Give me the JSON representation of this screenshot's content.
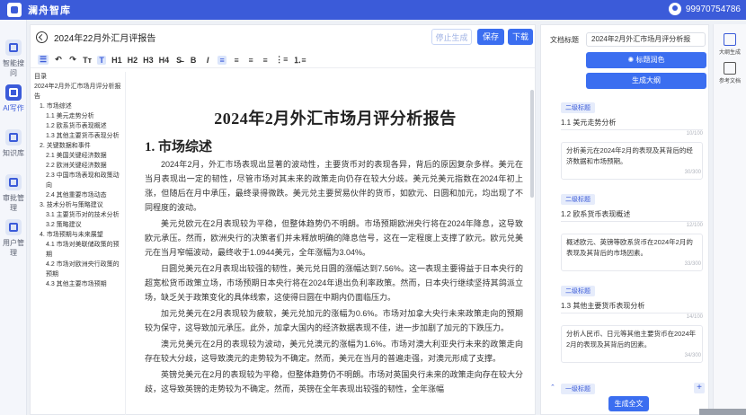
{
  "app": {
    "title": "澜舟智库",
    "user_phone": "99970754786"
  },
  "leftnav": [
    {
      "label": "智能搜问",
      "active": false
    },
    {
      "label": "AI写作",
      "active": true
    },
    {
      "label": "知识库",
      "active": false
    },
    {
      "label": "审批管理",
      "active": false
    },
    {
      "label": "用户管理",
      "active": false
    }
  ],
  "editor": {
    "doc_title": "2024年22月外汇月评报告",
    "buttons": {
      "stop": "停止生成",
      "save": "保存",
      "download": "下载"
    },
    "toolbar": [
      "H1",
      "H2",
      "H3",
      "H4",
      "B",
      "I"
    ],
    "toolbar_extra": {
      "tt1": "Tт",
      "tt2": "T"
    }
  },
  "outline": {
    "heading": "目录",
    "items": [
      {
        "text": "2024年2月外汇市场月评分析报告",
        "level": 0
      },
      {
        "text": "1. 市场综述",
        "level": 1
      },
      {
        "text": "1.1 美元走势分析",
        "level": 2
      },
      {
        "text": "1.2 欧系货币表现概述",
        "level": 2
      },
      {
        "text": "1.3 其他主要货币表现分析",
        "level": 2
      },
      {
        "text": "2. 关键数据和事件",
        "level": 1
      },
      {
        "text": "2.1 美国关键经济数据",
        "level": 2
      },
      {
        "text": "2.2 欧洲关键经济数据",
        "level": 2
      },
      {
        "text": "2.3 中国市场表现和政策动向",
        "level": 2
      },
      {
        "text": "2.4 其他重要市场动态",
        "level": 2
      },
      {
        "text": "3. 技术分析与策略建议",
        "level": 1
      },
      {
        "text": "3.1 主要货币对的技术分析",
        "level": 2
      },
      {
        "text": "3.2 策略建议",
        "level": 2
      },
      {
        "text": "4. 市场预期与未来展望",
        "level": 1
      },
      {
        "text": "4.1 市场对美联储政策的预期",
        "level": 2
      },
      {
        "text": "4.2 市场对欧洲央行政策的预期",
        "level": 2
      },
      {
        "text": "4.3 其他主要市场预期",
        "level": 2
      }
    ]
  },
  "content": {
    "title": "2024年2月外汇市场月评分析报告",
    "section1": "1. 市场综述",
    "paragraphs": [
      "2024年2月，外汇市场表现出显著的波动性，主要货币对的表现各异，背后的原因复杂多样。美元在当月表现出一定的韧性，尽管市场对其未来的政策走向仍存在较大分歧。美元兑美元指数在2024年初上涨，但随后在月中承压，最终录得微跌。美元兑主要贸易伙伴的货币，如欧元、日圆和加元，均出现了不同程度的波动。",
      "美元兑欧元在2月表现较为平稳，但整体趋势仍不明朗。市场预期欧洲央行将在2024年降息，这导致欧元承压。然而，欧洲央行的决策者们并未释放明确的降息信号，这在一定程度上支撑了欧元。欧元兑美元在当月窄幅波动，最终收于1.0944美元，全年涨幅为3.04%。",
      "日圆兑美元在2月表现出较强的韧性，美元兑日圆的涨幅达到7.56%。这一表现主要得益于日本央行的超宽松货币政策立场，市场预期日本央行将在2024年退出负利率政策。然而，日本央行继续坚持其鸽派立场，缺乏关于政策变化的具体线索，这使得日圆在中期内仍面临压力。",
      "加元兑美元在2月表现较为疲软，美元兑加元的涨幅为0.6%。市场对加拿大央行未来政策走向的预期较为保守，这导致加元承压。此外，加拿大国内的经济数据表现不佳，进一步加剧了加元的下跌压力。",
      "澳元兑美元在2月的表现较为波动，美元兑澳元的涨幅为1.6%。市场对澳大利亚央行未来的政策走向存在较大分歧，这导致澳元的走势较为不确定。然而，美元在当月的普遍走强，对澳元形成了支撑。",
      "英镑兑美元在2月的表现较为平稳，但整体趋势仍不明朗。市场对英国央行未来的政策走向存在较大分歧，这导致英镑的走势较为不确定。然而，英镑在全年表现出较强的韧性，全年涨幅"
    ]
  },
  "rightpanel": {
    "doc_title_label": "文档标题",
    "doc_title_value": "2024年2月外汇市场月评分析报",
    "btn_color": "标题润色",
    "btn_outline": "生成大纲",
    "cards": [
      {
        "badge": "二级标题",
        "title": "1.1 美元走势分析",
        "title_count": "10/100",
        "desc": "分析美元在2024年2月的表现及其背后的经济数据和市场预期。",
        "desc_count": "30/300"
      },
      {
        "badge": "二级标题",
        "title": "1.2 欧系货币表现概述",
        "title_count": "12/100",
        "desc": "概述欧元、英镑等欧系货币在2024年2月的表现及其背后的市场因素。",
        "desc_count": "33/300"
      },
      {
        "badge": "二级标题",
        "title": "1.3 其他主要货币表现分析",
        "title_count": "14/100",
        "desc": "分析人民币、日元等其他主要货币在2024年2月的表现及其背后的因素。",
        "desc_count": "34/300"
      }
    ],
    "l1_badge": "一级标题",
    "gen_full": "生成全文"
  },
  "rightrail": [
    {
      "label": "大纲生成"
    },
    {
      "label": "参考文档"
    }
  ]
}
